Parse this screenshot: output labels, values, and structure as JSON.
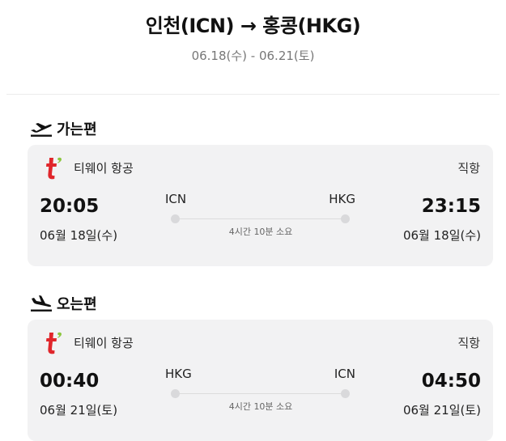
{
  "header": {
    "route": "인천(ICN) → 홍콩(HKG)",
    "dates": "06.18(수) - 06.21(토)"
  },
  "outbound": {
    "section_label": "가는편",
    "section_icon": "plane-takeoff-icon",
    "airline": "티웨이 항공",
    "airline_logo": "tway-logo-icon",
    "flight_type": "직항",
    "dep_time": "20:05",
    "dep_date": "06월 18일(수)",
    "dep_code": "ICN",
    "arr_code": "HKG",
    "arr_time": "23:15",
    "arr_date": "06월 18일(수)",
    "duration": "4시간 10분 소요"
  },
  "inbound": {
    "section_label": "오는편",
    "section_icon": "plane-landing-icon",
    "airline": "티웨이 항공",
    "airline_logo": "tway-logo-icon",
    "flight_type": "직항",
    "dep_time": "00:40",
    "dep_date": "06월 21일(토)",
    "dep_code": "HKG",
    "arr_code": "ICN",
    "arr_time": "04:50",
    "arr_date": "06월 21일(토)",
    "duration": "4시간 10분 소요"
  },
  "colors": {
    "logo_red": "#e0262b",
    "logo_green": "#8cc63f",
    "card_bg": "#f2f2f3"
  }
}
